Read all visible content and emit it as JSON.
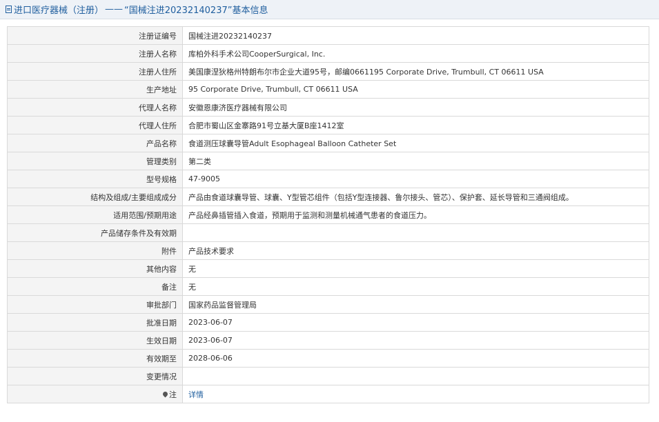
{
  "header": {
    "category": "进口医疗器械",
    "type": "（注册）",
    "separator": "——",
    "record_title": "“国械注进20232140237”基本信息"
  },
  "rows": [
    {
      "label": "注册证编号",
      "value": "国械注进20232140237"
    },
    {
      "label": "注册人名称",
      "value": "库柏外科手术公司CooperSurgical, Inc."
    },
    {
      "label": "注册人住所",
      "value": "美国康涅狄格州特朗布尔市企业大道95号，邮编0661195 Corporate Drive, Trumbull, CT 06611 USA"
    },
    {
      "label": "生产地址",
      "value": "95 Corporate Drive, Trumbull, CT 06611 USA"
    },
    {
      "label": "代理人名称",
      "value": "安徽恩康济医疗器械有限公司"
    },
    {
      "label": "代理人住所",
      "value": "合肥市蜀山区金寨路91号立基大厦B座1412室"
    },
    {
      "label": "产品名称",
      "value": "食道测压球囊导管Adult Esophageal Balloon Catheter Set"
    },
    {
      "label": "管理类别",
      "value": "第二类"
    },
    {
      "label": "型号规格",
      "value": "47-9005"
    },
    {
      "label": "结构及组成/主要组成成分",
      "value": "产品由食道球囊导管、球囊、Y型管芯组件（包括Y型连接器、鲁尔接头、管芯）、保护套、延长导管和三通阀组成。"
    },
    {
      "label": "适用范围/预期用途",
      "value": "产品经鼻插管插入食道，预期用于监测和测量机械通气患者的食道压力。"
    },
    {
      "label": "产品储存条件及有效期",
      "value": ""
    },
    {
      "label": "附件",
      "value": "产品技术要求"
    },
    {
      "label": "其他内容",
      "value": "无"
    },
    {
      "label": "备注",
      "value": "无"
    },
    {
      "label": "审批部门",
      "value": "国家药品监督管理局"
    },
    {
      "label": "批准日期",
      "value": "2023-06-07"
    },
    {
      "label": "生效日期",
      "value": "2023-06-07"
    },
    {
      "label": "有效期至",
      "value": "2028-06-06"
    },
    {
      "label": "变更情况",
      "value": ""
    }
  ],
  "note_row": {
    "label": "注",
    "link_text": "详情",
    "icon": "pin-icon"
  },
  "colors": {
    "header_text": "#1f5e9e",
    "header_bg": "#eef2f7",
    "label_bg": "#f4f4f4",
    "border": "#d9d9d9",
    "link": "#1f5e9e"
  }
}
